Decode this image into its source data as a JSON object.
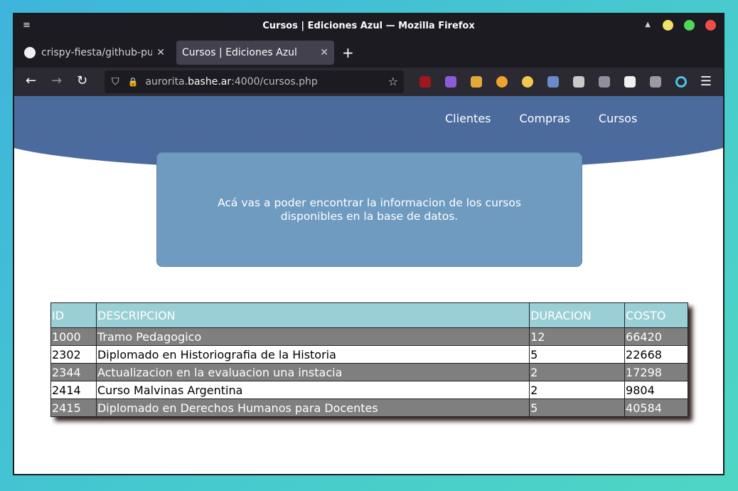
{
  "window": {
    "title": "Cursos | Ediciones Azul — Mozilla Firefox"
  },
  "tabs": [
    {
      "label": "crispy-fiesta/github-push",
      "active": false
    },
    {
      "label": "Cursos | Ediciones Azul",
      "active": true
    }
  ],
  "urlbar": {
    "prefix": "aurorita.",
    "host": "bashe.ar",
    "rest": ":4000/cursos.php"
  },
  "site_nav": [
    {
      "label": "Clientes"
    },
    {
      "label": "Compras"
    },
    {
      "label": "Cursos"
    }
  ],
  "info_text": "Acá vas a poder encontrar la informacion de los cursos disponibles en la base de datos.",
  "table": {
    "headers": [
      "ID",
      "DESCRIPCION",
      "DURACION",
      "COSTO"
    ],
    "rows": [
      [
        "1000",
        "Tramo Pedagogico",
        "12",
        "66420"
      ],
      [
        "2302",
        "Diplomado en Historiografia de la Historia",
        "5",
        "22668"
      ],
      [
        "2344",
        "Actualizacion en la evaluacion una instacia",
        "2",
        "17298"
      ],
      [
        "2414",
        "Curso Malvinas Argentina",
        "2",
        "9804"
      ],
      [
        "2415",
        "Diplomado en Derechos Humanos para Docentes",
        "5",
        "40584"
      ]
    ]
  },
  "colors": {
    "header_blue": "#4e6e9e",
    "card_blue": "#6f9bc0",
    "table_header": "#99cfd5",
    "row_gray": "#7f7f7f"
  },
  "icons": {
    "extensions": [
      "ublock-icon",
      "cube-icon",
      "broom-icon",
      "cookie-icon",
      "emoji-icon",
      "pen-icon",
      "frog-icon",
      "puzzle-icon",
      "p-icon",
      "font-icon",
      "color-ring-icon"
    ]
  }
}
